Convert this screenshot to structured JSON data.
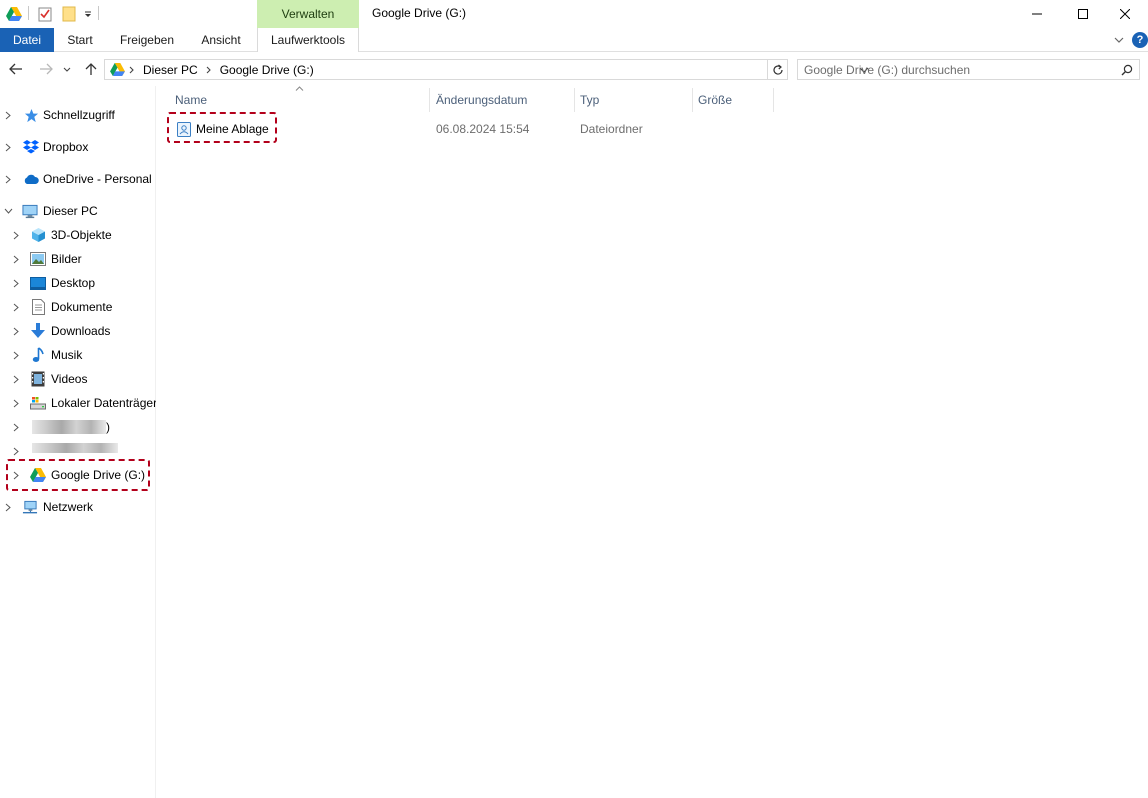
{
  "window": {
    "title": "Google Drive (G:)"
  },
  "ribbon": {
    "contextual_header": "Verwalten",
    "tabs": [
      {
        "label": "Datei"
      },
      {
        "label": "Start"
      },
      {
        "label": "Freigeben"
      },
      {
        "label": "Ansicht"
      },
      {
        "label": "Laufwerktools"
      }
    ],
    "help": "?"
  },
  "address": {
    "breadcrumbs": [
      {
        "label": "Dieser PC"
      },
      {
        "label": "Google Drive (G:)"
      }
    ]
  },
  "search": {
    "placeholder": "Google Drive (G:) durchsuchen",
    "value": ""
  },
  "navigation": {
    "items": [
      {
        "label": "Schnellzugriff",
        "icon": "star-icon",
        "expanded": false
      },
      {
        "label": "Dropbox",
        "icon": "dropbox-icon",
        "expanded": false
      },
      {
        "label": "OneDrive - Personal",
        "icon": "cloud-icon",
        "expanded": false
      },
      {
        "label": "Dieser PC",
        "icon": "computer-icon",
        "expanded": true
      },
      {
        "label": "3D-Objekte",
        "icon": "cube-icon",
        "expanded": false
      },
      {
        "label": "Bilder",
        "icon": "pictures-icon",
        "expanded": false
      },
      {
        "label": "Desktop",
        "icon": "desktop-icon",
        "expanded": false
      },
      {
        "label": "Dokumente",
        "icon": "document-icon",
        "expanded": false
      },
      {
        "label": "Downloads",
        "icon": "download-icon",
        "expanded": false
      },
      {
        "label": "Musik",
        "icon": "music-icon",
        "expanded": false
      },
      {
        "label": "Videos",
        "icon": "film-icon",
        "expanded": false
      },
      {
        "label": "Lokaler Datenträger",
        "icon": "drive-icon",
        "expanded": false
      },
      {
        "label": ")",
        "icon": "redacted",
        "expanded": false
      },
      {
        "label": "",
        "icon": "redacted",
        "expanded": false
      },
      {
        "label": "Google Drive (G:)",
        "icon": "google-drive-icon",
        "expanded": false,
        "selected": true
      },
      {
        "label": "Netzwerk",
        "icon": "network-icon",
        "expanded": false
      }
    ]
  },
  "file_list": {
    "columns": [
      {
        "label": "Name"
      },
      {
        "label": "Änderungsdatum"
      },
      {
        "label": "Typ"
      },
      {
        "label": "Größe"
      }
    ],
    "rows": [
      {
        "name": "Meine Ablage",
        "modified": "06.08.2024 15:54",
        "type": "Dateiordner",
        "size": "",
        "icon": "shared-drive-folder-icon"
      }
    ]
  },
  "colors": {
    "accent": "#1a62b5",
    "contextual_tab": "#cdeeb1",
    "highlight_border": "#b3001b",
    "column_header_text": "#4c607a"
  }
}
